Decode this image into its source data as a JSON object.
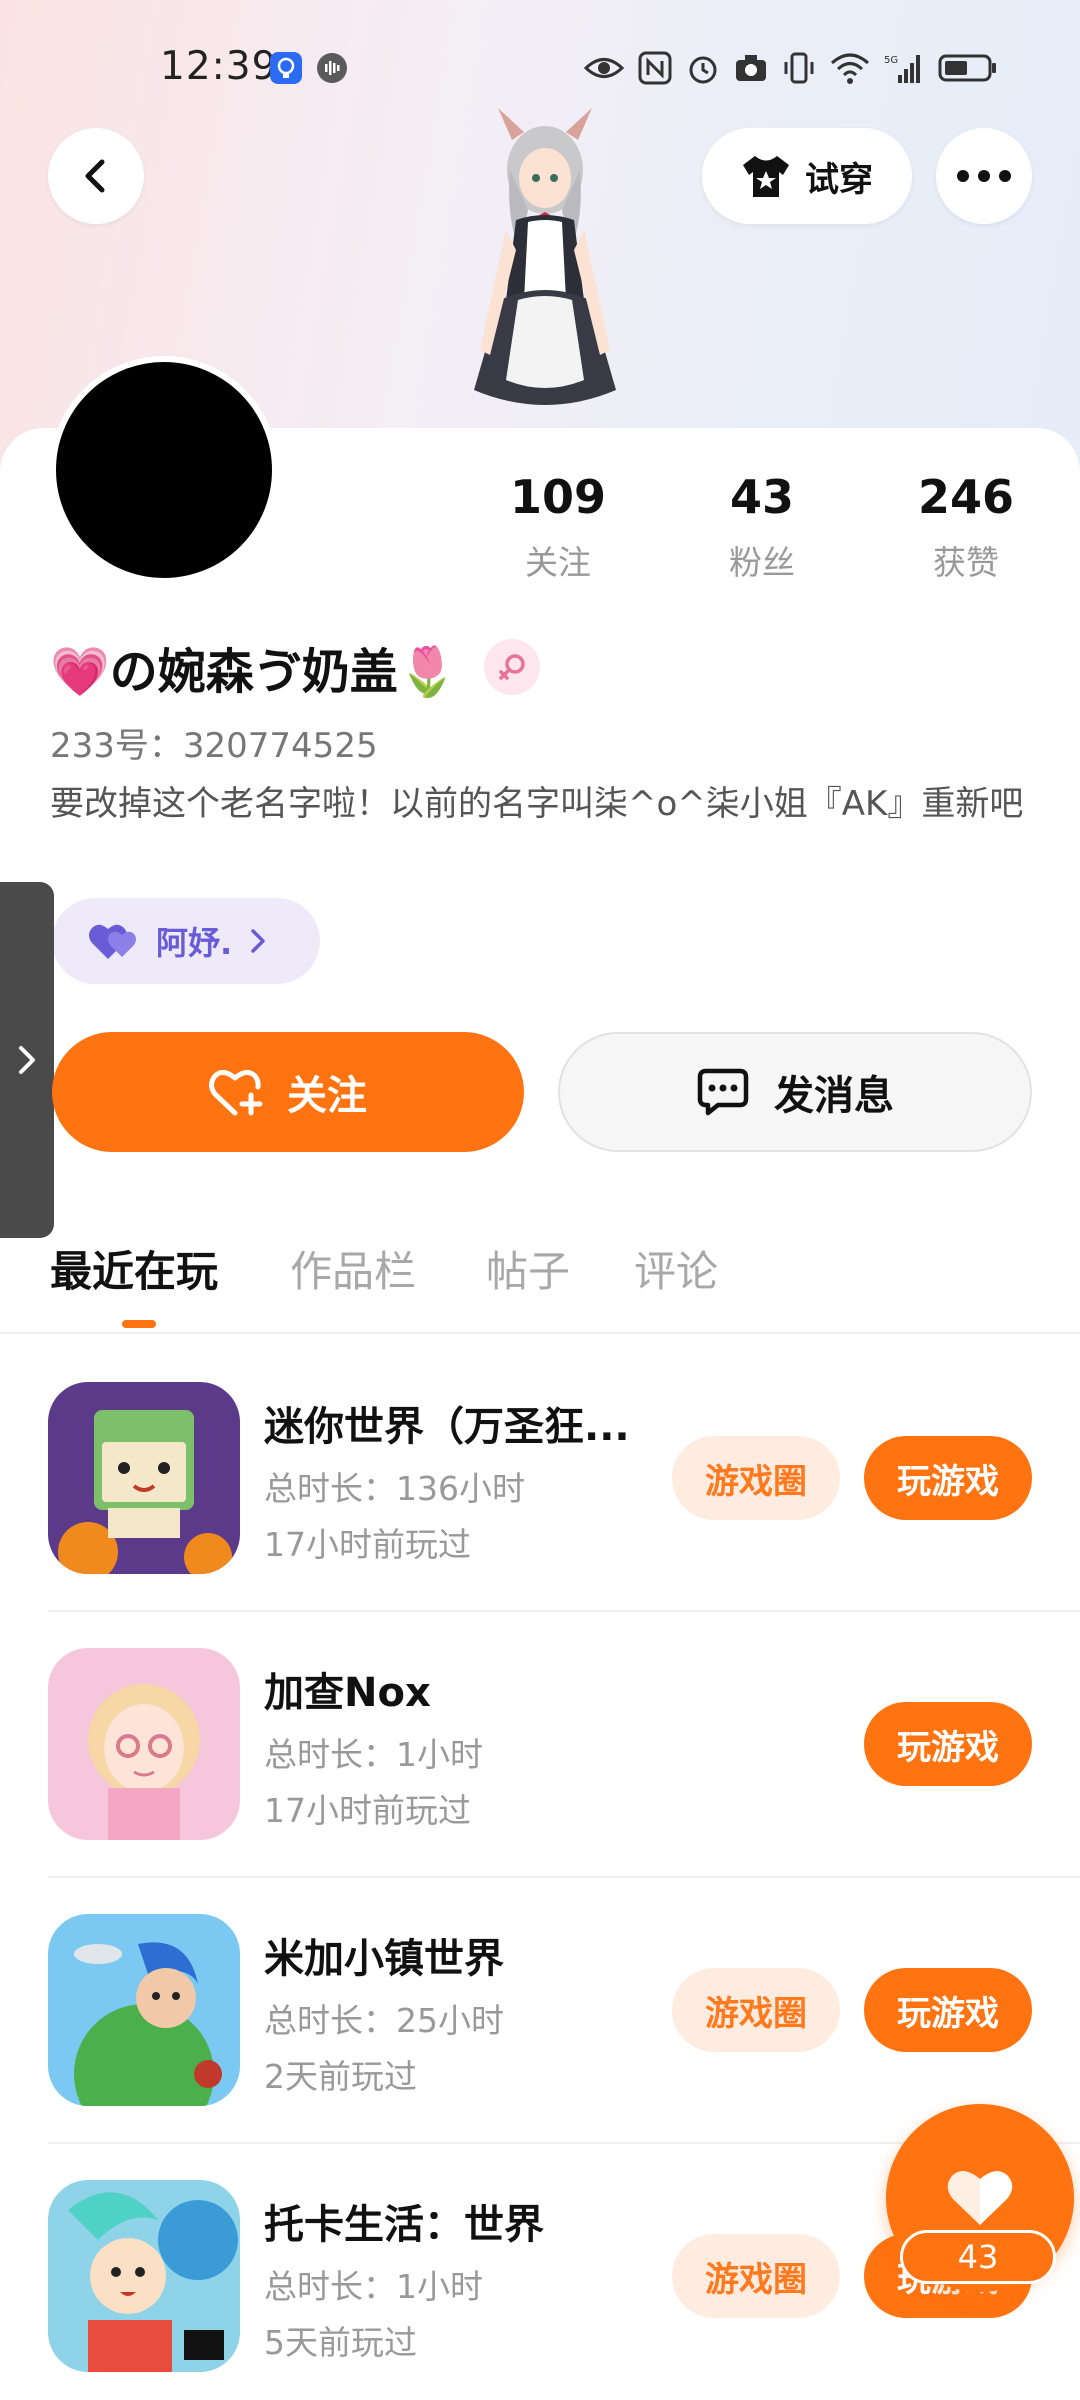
{
  "status_bar": {
    "time": "12:39"
  },
  "header": {
    "tryon_label": "试穿"
  },
  "profile": {
    "stats": [
      {
        "value": "109",
        "label": "关注"
      },
      {
        "value": "43",
        "label": "粉丝"
      },
      {
        "value": "246",
        "label": "获赞"
      }
    ],
    "name": "💗の婉森ゔ奶盖🌷",
    "uid": "233号：320774525",
    "bio": "要改掉这个老名字啦！以前的名字叫柒^o^柒小姐『AK』重新吧",
    "tag_label": "阿妤.",
    "follow_label": "关注",
    "message_label": "发消息"
  },
  "tabs": [
    {
      "label": "最近在玩",
      "active": true
    },
    {
      "label": "作品栏",
      "active": false
    },
    {
      "label": "帖子",
      "active": false
    },
    {
      "label": "评论",
      "active": false
    }
  ],
  "games": [
    {
      "title": "迷你世界（万圣狂...",
      "duration": "总时长：136小时",
      "last_played": "17小时前玩过",
      "circle_label": "游戏圈",
      "play_label": "玩游戏",
      "has_circle": true
    },
    {
      "title": "加查Nox",
      "duration": "总时长：1小时",
      "last_played": "17小时前玩过",
      "circle_label": "",
      "play_label": "玩游戏",
      "has_circle": false
    },
    {
      "title": "米加小镇世界",
      "duration": "总时长：25小时",
      "last_played": "2天前玩过",
      "circle_label": "游戏圈",
      "play_label": "玩游戏",
      "has_circle": true
    },
    {
      "title": "托卡生活：世界",
      "duration": "总时长：1小时",
      "last_played": "5天前玩过",
      "circle_label": "游戏圈",
      "play_label": "玩游戏",
      "has_circle": true
    }
  ],
  "fab": {
    "like_count": "43"
  },
  "colors": {
    "accent": "#ff7310",
    "chip_bg": "#ffece0",
    "tag_bg": "#eeeaf9",
    "tag_text": "#6a5bd6"
  },
  "icons": {
    "back": "chevron-left-icon",
    "tryon": "tshirt-icon",
    "more": "more-dots-icon",
    "gender": "female-icon",
    "tag": "heart-icon",
    "follow": "heart-plus-icon",
    "message": "chat-bubble-icon",
    "side": "chevron-right-icon",
    "fab": "heart-icon"
  }
}
